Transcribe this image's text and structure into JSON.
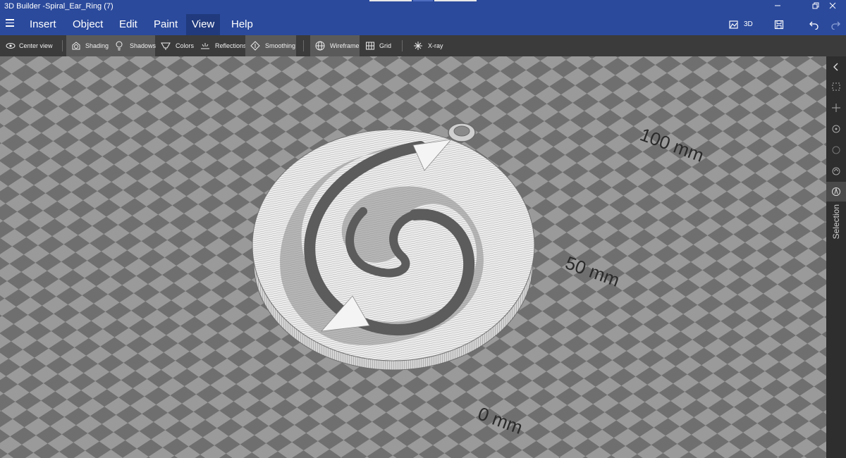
{
  "window": {
    "title": "3D Builder -Spiral_Ear_Ring (7)",
    "minimize_icon": "minimize-icon",
    "restore_icon": "restore-icon",
    "close_icon": "close-icon"
  },
  "menu": {
    "items": [
      "Insert",
      "Object",
      "Edit",
      "Paint",
      "View",
      "Help"
    ],
    "active": "View",
    "print_label": "3D Print",
    "icons": [
      "hamburger-menu-icon",
      "print-3d-icon",
      "save-icon",
      "undo-icon",
      "redo-icon"
    ]
  },
  "toolbar": {
    "center_view": "Center view",
    "shading": "Shading",
    "shadows": "Shadows",
    "colors": "Colors",
    "reflections": "Reflections",
    "smoothing": "Smoothing",
    "wireframe": "Wireframe",
    "grid": "Grid",
    "xray": "X-ray",
    "active_items": [
      "Shading",
      "Shadows",
      "Smoothing",
      "Wireframe"
    ]
  },
  "viewport": {
    "labels": [
      "100 mm",
      "50 mm",
      "0 mm"
    ],
    "object_name": "Spiral_Ear_Ring"
  },
  "right_panel": {
    "label": "Selection",
    "icons": [
      "collapse-chevron-icon",
      "select-icon",
      "move-icon",
      "rotate-icon",
      "scale-icon",
      "snap-icon",
      "selection-mode-icon"
    ]
  },
  "colors": {
    "accent": "#2b4a9c",
    "toolbar_bg": "#3b3b3b",
    "floor_dark": "#6f6f6f",
    "floor_light": "#9a9a9a",
    "model": "#e6e6e6"
  }
}
